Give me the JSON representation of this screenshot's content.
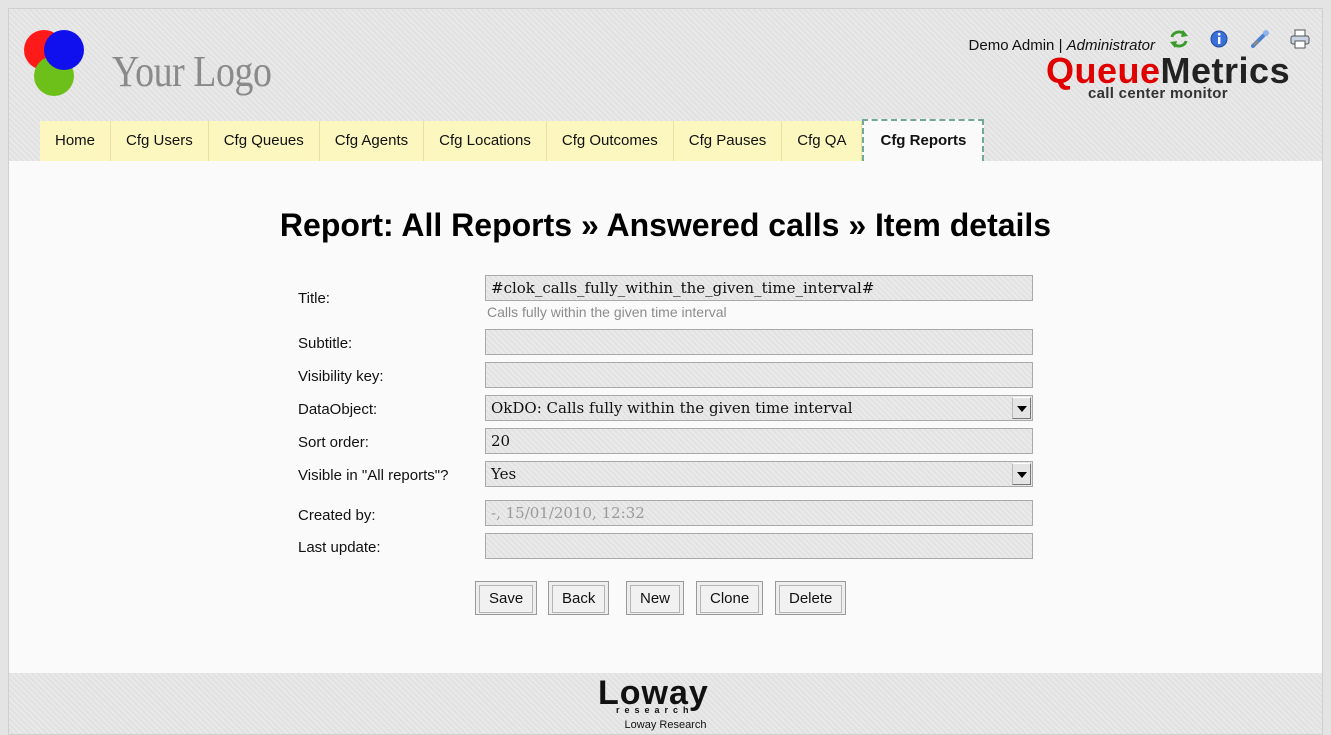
{
  "logo": {
    "text": "Your Logo"
  },
  "header": {
    "user_name": "Demo Admin",
    "separator": " | ",
    "role": "Administrator",
    "icons": [
      "refresh-icon",
      "info-icon",
      "tools-icon",
      "print-icon"
    ],
    "brand_q": "Queue",
    "brand_m": "Metrics",
    "brand_sub": "call center monitor"
  },
  "tabs": [
    {
      "label": "Home"
    },
    {
      "label": "Cfg Users"
    },
    {
      "label": "Cfg Queues"
    },
    {
      "label": "Cfg Agents"
    },
    {
      "label": "Cfg Locations"
    },
    {
      "label": "Cfg Outcomes"
    },
    {
      "label": "Cfg Pauses"
    },
    {
      "label": "Cfg QA"
    },
    {
      "label": "Cfg Reports",
      "active": true
    }
  ],
  "page_title": "Report: All Reports » Answered calls » Item details",
  "form": {
    "title_label": "Title:",
    "title_value": "#clok_calls_fully_within_the_given_time_interval#",
    "title_hint": "Calls fully within the given time interval",
    "subtitle_label": "Subtitle:",
    "subtitle_value": "",
    "visibility_label": "Visibility key:",
    "visibility_value": "",
    "dataobject_label": "DataObject:",
    "dataobject_value": "OkDO: Calls fully within the given time interval",
    "sort_label": "Sort order:",
    "sort_value": "20",
    "visible_label": "Visible in \"All reports\"?",
    "visible_value": "Yes",
    "created_label": "Created by:",
    "created_value": "-, 15/01/2010, 12:32",
    "updated_label": "Last update:",
    "updated_value": ""
  },
  "buttons": {
    "save": "Save",
    "back": "Back",
    "new": "New",
    "clone": "Clone",
    "delete": "Delete"
  },
  "footer": {
    "logo_big": "Loway",
    "logo_small": "research",
    "text": "Loway Research"
  },
  "colors": {
    "tab_bg": "#fbf7bf",
    "active_tab_border": "#72a89b",
    "brand_red": "#e00000"
  }
}
